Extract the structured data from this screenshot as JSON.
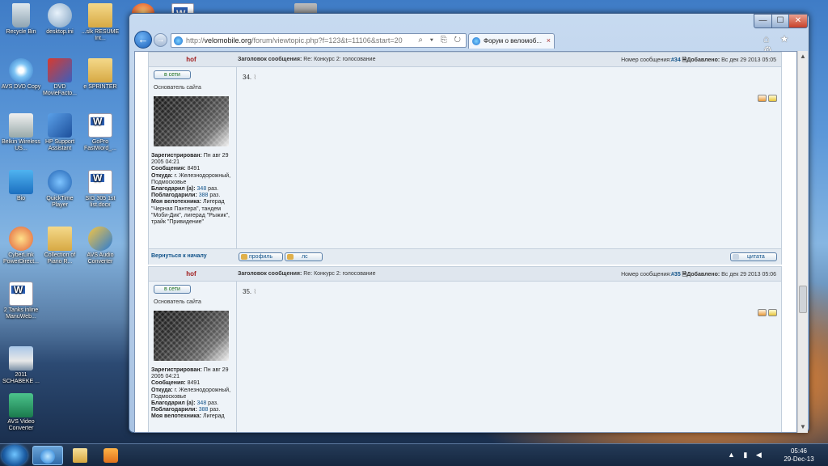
{
  "desktop": {
    "icons": [
      {
        "label": "Recycle Bin",
        "icon": "recycle-bin-icon"
      },
      {
        "label": "desktop.ini",
        "icon": "network-file-icon"
      },
      {
        "label": "...slk RESUME Int...",
        "icon": "folder-icon"
      },
      {
        "label": "AVS DVD Copy",
        "icon": "dvd-icon"
      },
      {
        "label": "DVD MovieFacto...",
        "icon": "dvd-factory-icon"
      },
      {
        "label": "e SPRINTER",
        "icon": "folder-icon"
      },
      {
        "label": "Belkin Wireless US...",
        "icon": "wireless-icon"
      },
      {
        "label": "HP Support Assistant",
        "icon": "hp-icon"
      },
      {
        "label": "GoPro FastWord_...",
        "icon": "word-doc-icon"
      },
      {
        "label": "Bio",
        "icon": "bio-icon"
      },
      {
        "label": "QuickTime Player",
        "icon": "quicktime-icon"
      },
      {
        "label": "SIG 305 1st list.docx",
        "icon": "word-doc-icon"
      },
      {
        "label": "CyberLink PowerDirect...",
        "icon": "cyberlink-icon"
      },
      {
        "label": "Collection of Piano R...",
        "icon": "folder-icon"
      },
      {
        "label": "AVS Audio Converter",
        "icon": "avs-audio-icon"
      },
      {
        "label": "2 Tanks inline ManuWeb...",
        "icon": "word-doc-icon"
      },
      {
        "label": "2011 SCHABEKE ...",
        "icon": "photo-icon"
      },
      {
        "label": "AVS Video Converter",
        "icon": "avs-video-icon"
      }
    ]
  },
  "browser": {
    "window_controls": {
      "minimize": "—",
      "maximize": "☐",
      "close": "✕"
    },
    "back": "←",
    "forward": "→",
    "url_prefix": "http://",
    "url_host": "velomobile.org",
    "url_path": "/forum/viewtopic.php?f=123&t=11106&start=20",
    "address_tools": "⌕ ▾ ⎘ ↻",
    "tab_title": "Форум о веломоб...",
    "tab_close": "×",
    "toolbar_icons": "⌂ ★ ⚙"
  },
  "posts": [
    {
      "author": "hof",
      "subject_label": "Заголовок сообщения:",
      "subject": "Re: Конкурс 2: голосование",
      "number_label": "Номер сообщения:",
      "number": "#34",
      "added_label": "Добавлено:",
      "date": "Вс дек 29 2013 05:05",
      "status": "в сети",
      "rank": "Основатель сайта",
      "registered_label": "Зарегистрирован:",
      "registered": "Пн авг 29 2005 04:21",
      "messages_label": "Сообщения:",
      "messages": "8491",
      "from_label": "Откуда:",
      "from": "г. Железнодорожный, Подмосковье",
      "thanked_label": "Благодарил (а):",
      "thanked": "348",
      "thanked_suffix": "раз.",
      "thanks_label": "Поблагодарили:",
      "thanks": "388",
      "thanks_suffix": "раз.",
      "tech_label": "Моя велотехника:",
      "tech": "Лигерад \"Черная Пантера\", тандем \"Моби-Дик\", лигерад \"Рыжик\", трайк \"Привидение\"",
      "body": "34."
    },
    {
      "author": "hof",
      "subject_label": "Заголовок сообщения:",
      "subject": "Re: Конкурс 2: голосование",
      "number_label": "Номер сообщения:",
      "number": "#35",
      "added_label": "Добавлено:",
      "date": "Вс дек 29 2013 05:06",
      "status": "в сети",
      "rank": "Основатель сайта",
      "registered_label": "Зарегистрирован:",
      "registered": "Пн авг 29 2005 04:21",
      "messages_label": "Сообщения:",
      "messages": "8491",
      "from_label": "Откуда:",
      "from": "г. Железнодорожный, Подмосковье",
      "thanked_label": "Благодарил (а):",
      "thanked": "348",
      "thanked_suffix": "раз.",
      "thanks_label": "Поблагодарили:",
      "thanks": "388",
      "thanks_suffix": "раз.",
      "tech_label": "Моя велотехника:",
      "tech": "Лигерад",
      "body": "35."
    }
  ],
  "post_footer": {
    "back_to_top": "Вернуться к началу",
    "profile": "профиль",
    "pm": "лс",
    "quote": "цитата"
  },
  "taskbar": {
    "time": "05:46",
    "date": "29-Dec-13",
    "tray_icons": "▲ ▮ ◀"
  },
  "colors": {
    "author": "#a01d1d",
    "link": "#105289",
    "post_bg": "#eef3f8",
    "online": "#1a6e1a"
  }
}
